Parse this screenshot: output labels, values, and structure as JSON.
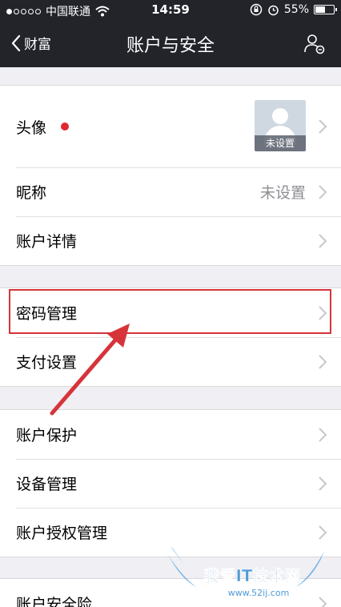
{
  "status_bar": {
    "carrier": "中国联通",
    "time": "14:59",
    "battery": "55%",
    "battery_level": 0.55
  },
  "nav": {
    "back_label": "财富",
    "title": "账户与安全"
  },
  "group1": {
    "avatar_label": "头像",
    "avatar_caption": "未设置",
    "nickname_label": "昵称",
    "nickname_value": "未设置",
    "account_detail_label": "账户详情"
  },
  "group2": {
    "password_label": "密码管理",
    "payment_label": "支付设置"
  },
  "group3": {
    "protect_label": "账户保护",
    "device_label": "设备管理",
    "auth_label": "账户授权管理"
  },
  "group4": {
    "insurance_label": "账户安全险"
  },
  "watermark": {
    "text": "我爱IT技术网",
    "url": "www.52ij.com"
  },
  "colors": {
    "topbar": "#22242a",
    "background": "#efeff4",
    "highlight": "#d6343a",
    "badge_dot": "#e0282f"
  }
}
